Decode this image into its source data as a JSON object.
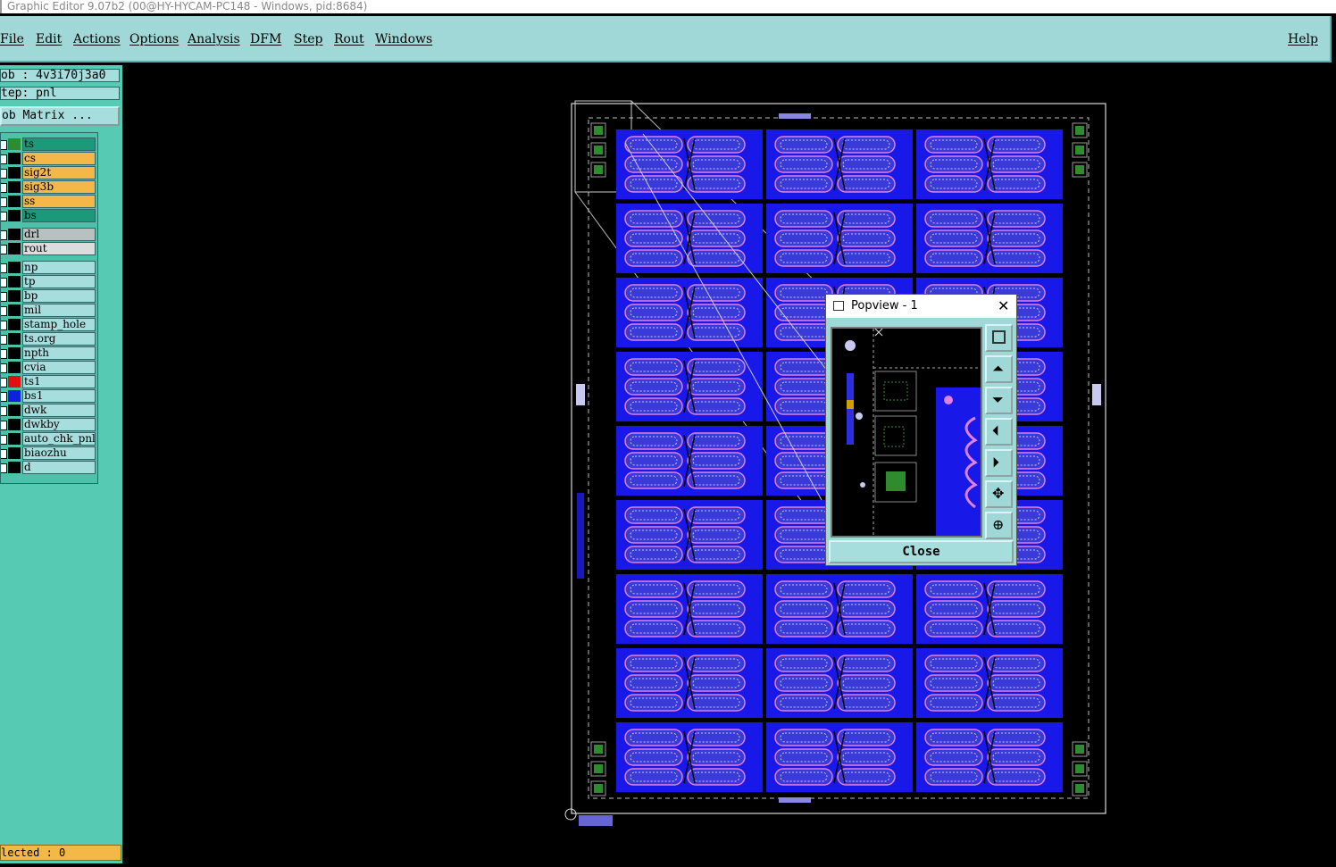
{
  "window": {
    "title": "Graphic Editor 9.07b2 (00@HY-HYCAM-PC148 - Windows, pid:8684)"
  },
  "menu": {
    "items": [
      "File",
      "Edit",
      "Actions",
      "Options",
      "Analysis",
      "DFM",
      "Step",
      "Rout",
      "Windows"
    ],
    "help": "Help"
  },
  "left": {
    "job": "ob : 4v3i70j3a0",
    "step": "tep: pnl",
    "matrix_button": "ob Matrix ...",
    "selected": "lected : 0"
  },
  "layers": [
    {
      "name": "ts",
      "bg": "#1a9a78",
      "swatch": "#2e8b2e"
    },
    {
      "name": "cs",
      "bg": "#f3b848",
      "swatch": "#000000"
    },
    {
      "name": "sig2t",
      "bg": "#f3b848",
      "swatch": "#000000"
    },
    {
      "name": "sig3b",
      "bg": "#f3b848",
      "swatch": "#000000"
    },
    {
      "name": "ss",
      "bg": "#f3b848",
      "swatch": "#000000"
    },
    {
      "name": "bs",
      "bg": "#1a9a78",
      "swatch": "#000000"
    },
    {
      "name": "drl",
      "bg": "#b8c0c0",
      "swatch": "#000000"
    },
    {
      "name": "rout",
      "bg": "#dcdcdc",
      "swatch": "#000000"
    },
    {
      "name": "np",
      "bg": "#a6dddd",
      "swatch": "#000000"
    },
    {
      "name": "tp",
      "bg": "#a6dddd",
      "swatch": "#000000"
    },
    {
      "name": "bp",
      "bg": "#a6dddd",
      "swatch": "#000000"
    },
    {
      "name": "mil",
      "bg": "#a6dddd",
      "swatch": "#000000"
    },
    {
      "name": "stamp_hole",
      "bg": "#a6dddd",
      "swatch": "#000000"
    },
    {
      "name": "ts.org",
      "bg": "#a6dddd",
      "swatch": "#000000"
    },
    {
      "name": "npth",
      "bg": "#a6dddd",
      "swatch": "#000000"
    },
    {
      "name": "cvia",
      "bg": "#a6dddd",
      "swatch": "#000000"
    },
    {
      "name": "ts1",
      "bg": "#a6dddd",
      "swatch": "#e01010"
    },
    {
      "name": "bs1",
      "bg": "#a6dddd",
      "swatch": "#1020e0"
    },
    {
      "name": "dwk",
      "bg": "#a6dddd",
      "swatch": "#000000"
    },
    {
      "name": "dwkby",
      "bg": "#a6dddd",
      "swatch": "#000000"
    },
    {
      "name": "auto_chk_pnl",
      "bg": "#a6dddd",
      "swatch": "#000000"
    },
    {
      "name": "biaozhu",
      "bg": "#a6dddd",
      "swatch": "#000000"
    },
    {
      "name": "d",
      "bg": "#a6dddd",
      "swatch": "#000000"
    }
  ],
  "popview": {
    "title": "Popview - 1",
    "close_label": "Close"
  },
  "colors": {
    "panel": "#9fd8d7",
    "board_blue": "#1818e8",
    "pad_green": "#2e8b2e",
    "selected_yellow": "#f3b848"
  }
}
